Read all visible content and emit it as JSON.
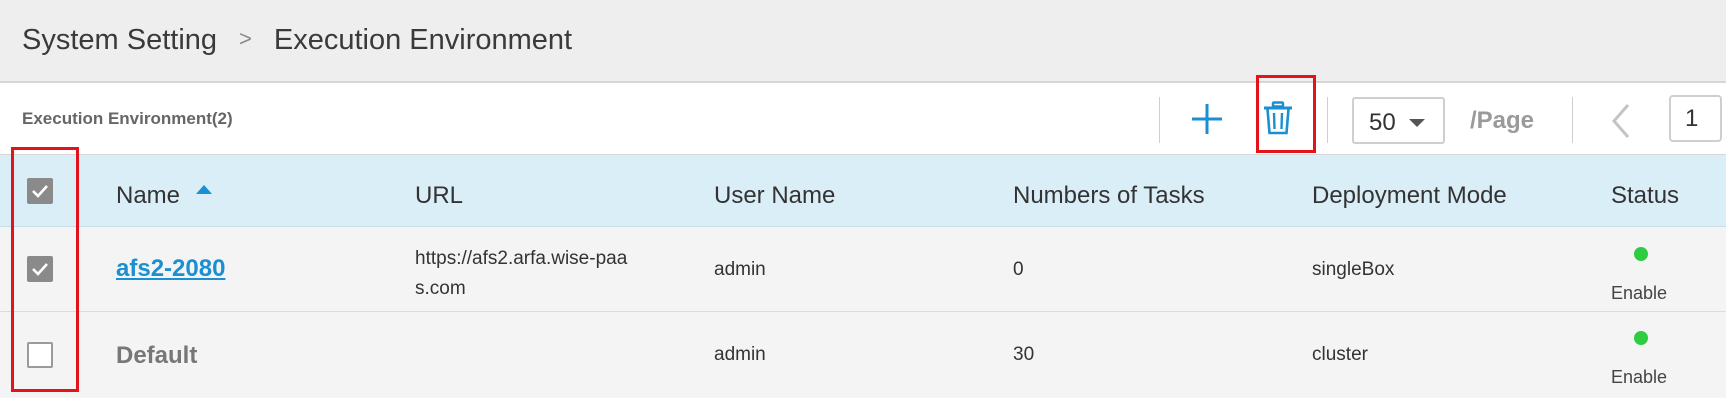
{
  "breadcrumb": {
    "root": "System Setting",
    "separator": ">",
    "current": "Execution Environment"
  },
  "toolbar": {
    "count_label": "Execution Environment(2)",
    "page_size": "50",
    "per_page_label": "/Page",
    "page_number": "1"
  },
  "table": {
    "columns": [
      "Name",
      "URL",
      "User Name",
      "Numbers of Tasks",
      "Deployment Mode",
      "Status"
    ],
    "sort": {
      "column": "Name",
      "direction": "ascending"
    },
    "rows": [
      {
        "checked": true,
        "name": "afs2-2080",
        "url_line1": "https://afs2.arfa.wise-paa",
        "url_line2": "s.com",
        "user": "admin",
        "tasks": "0",
        "mode": "singleBox",
        "status": "Enable"
      },
      {
        "checked": false,
        "name": "Default",
        "url_line1": "",
        "url_line2": "",
        "user": "admin",
        "tasks": "30",
        "mode": "cluster",
        "status": "Enable"
      }
    ],
    "header_checkbox_checked": true
  },
  "colors": {
    "accent": "#1a8fd1",
    "header_row_bg": "#daeef8",
    "status_enable": "#2ecc40",
    "highlight": "#e3131b"
  },
  "icons": [
    "add-icon",
    "trash-icon",
    "chevron-left-icon",
    "caret-down-icon",
    "sort-ascending-icon",
    "check-icon"
  ]
}
